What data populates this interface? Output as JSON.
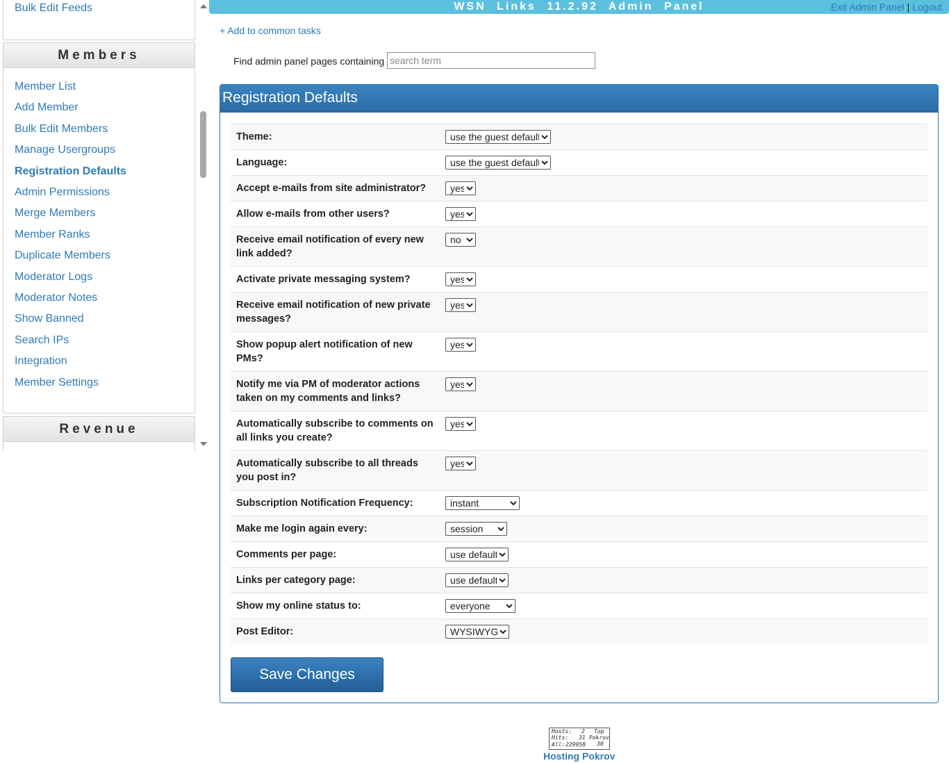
{
  "sidebar": {
    "bulk_edit_feeds": "Bulk Edit Feeds",
    "members_heading": "Members",
    "members_items": [
      "Member List",
      "Add Member",
      "Bulk Edit Members",
      "Manage Usergroups",
      "Registration Defaults",
      "Admin Permissions",
      "Merge Members",
      "Member Ranks",
      "Duplicate Members",
      "Moderator Logs",
      "Moderator Notes",
      "Show Banned",
      "Search IPs",
      "Integration",
      "Member Settings"
    ],
    "active_item": "Registration Defaults",
    "revenue_heading": "Revenue"
  },
  "header": {
    "title": "WSN Links 11.2.92 Admin Panel",
    "exit_label": "Exit Admin Panel",
    "separator": "|",
    "logout_label": "Logout"
  },
  "tasks": {
    "add_common": "+ Add to common tasks"
  },
  "search": {
    "label": "Find admin panel pages containing",
    "placeholder": "search term",
    "value": ""
  },
  "panel": {
    "title": "Registration Defaults",
    "rows": [
      {
        "label": "Theme:",
        "value": "use the guest default"
      },
      {
        "label": "Language:",
        "value": "use the guest default"
      },
      {
        "label": "Accept e-mails from site administrator?",
        "value": "yes"
      },
      {
        "label": "Allow e-mails from other users?",
        "value": "yes"
      },
      {
        "label": "Receive email notification of every new link added?",
        "value": "no"
      },
      {
        "label": "Activate private messaging system?",
        "value": "yes"
      },
      {
        "label": "Receive email notification of new private messages?",
        "value": "yes"
      },
      {
        "label": "Show popup alert notification of new PMs?",
        "value": "yes"
      },
      {
        "label": "Notify me via PM of moderator actions taken on my comments and links?",
        "value": "yes"
      },
      {
        "label": "Automatically subscribe to comments on all links you create?",
        "value": "yes"
      },
      {
        "label": "Automatically subscribe to all threads you post in?",
        "value": "yes"
      },
      {
        "label": "Subscription Notification Frequency:",
        "value": "instant"
      },
      {
        "label": "Make me login again every:",
        "value": "session"
      },
      {
        "label": "Comments per page:",
        "value": "use default"
      },
      {
        "label": "Links per category page:",
        "value": "use default"
      },
      {
        "label": "Show my online status to:",
        "value": "everyone"
      },
      {
        "label": "Post Editor:",
        "value": "WYSIWYG"
      }
    ],
    "save_label": "Save Changes"
  },
  "footer": {
    "counter": {
      "hosts_label": "Hosts:",
      "hosts_value": "2",
      "hits_label": "Hits:",
      "hits_value": "31",
      "all_label": "All:",
      "all_value": "229958",
      "top_label": "Top",
      "brand_label": "Pokrov",
      "rank_value": "30"
    },
    "hosting_label": "Hosting Pokrov"
  }
}
